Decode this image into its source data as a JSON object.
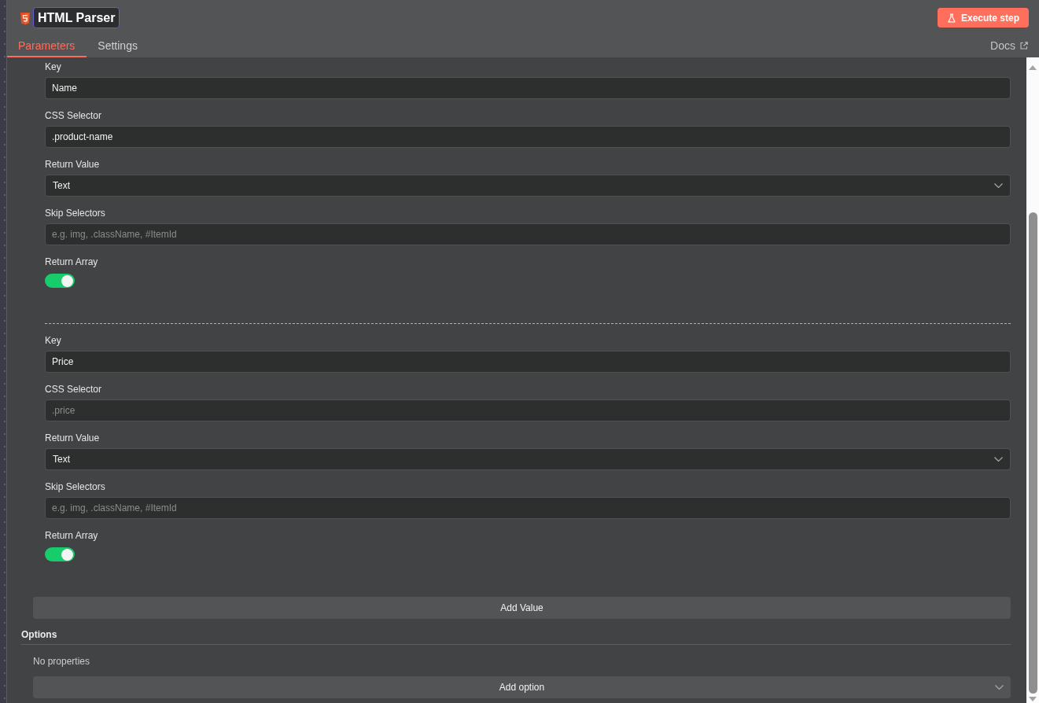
{
  "node": {
    "title": "HTML Parser",
    "execute_button": "Execute step"
  },
  "tabs": [
    {
      "label": "Parameters",
      "selected": true
    },
    {
      "label": "Settings",
      "selected": false
    }
  ],
  "docs_link": "Docs",
  "extraction_values": [
    {
      "fields": [
        {
          "kind": "text",
          "label": "Key",
          "value": "Name"
        },
        {
          "kind": "text",
          "label": "CSS Selector",
          "value": ".product-name"
        },
        {
          "kind": "select",
          "label": "Return Value",
          "value": "Text"
        },
        {
          "kind": "text",
          "label": "Skip Selectors",
          "placeholder": "e.g. img, .className, #ItemId"
        },
        {
          "kind": "toggle",
          "label": "Return Array",
          "on": true
        }
      ]
    },
    {
      "fields": [
        {
          "kind": "text",
          "label": "Key",
          "value": "Price"
        },
        {
          "kind": "text",
          "label": "CSS Selector",
          "placeholder": ".price"
        },
        {
          "kind": "select",
          "label": "Return Value",
          "value": "Text"
        },
        {
          "kind": "text",
          "label": "Skip Selectors",
          "placeholder": "e.g. img, .className, #ItemId"
        },
        {
          "kind": "toggle",
          "label": "Return Array",
          "on": true
        }
      ]
    }
  ],
  "add_value_button": "Add Value",
  "options": {
    "title": "Options",
    "empty_text": "No properties",
    "add_button": "Add option"
  }
}
